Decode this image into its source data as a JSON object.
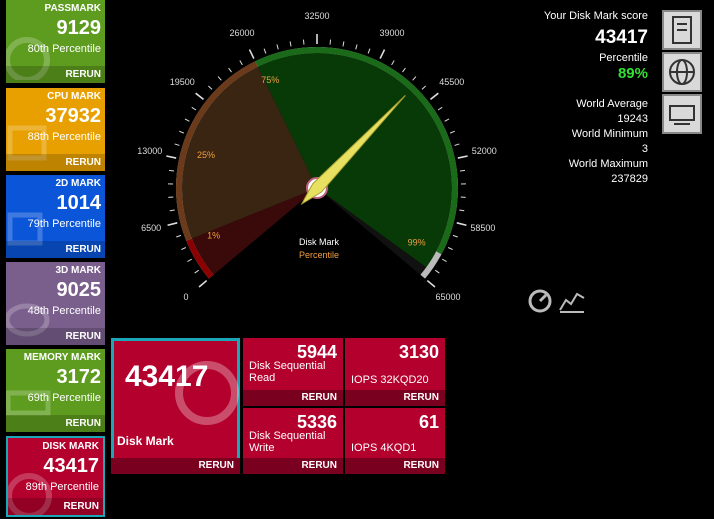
{
  "tiles": [
    {
      "name": "PASSMARK",
      "score": "9129",
      "pct": "80th Percentile",
      "rerun": "RERUN",
      "color": "#5e9c1f"
    },
    {
      "name": "CPU MARK",
      "score": "37932",
      "pct": "88th Percentile",
      "rerun": "RERUN",
      "color": "#e8a000"
    },
    {
      "name": "2D MARK",
      "score": "1014",
      "pct": "79th Percentile",
      "rerun": "RERUN",
      "color": "#0a55d8"
    },
    {
      "name": "3D MARK",
      "score": "9025",
      "pct": "48th Percentile",
      "rerun": "RERUN",
      "color": "#7a5f8c"
    },
    {
      "name": "MEMORY MARK",
      "score": "3172",
      "pct": "69th Percentile",
      "rerun": "RERUN",
      "color": "#5e9c1f"
    },
    {
      "name": "DISK MARK",
      "score": "43417",
      "pct": "89th Percentile",
      "rerun": "RERUN",
      "color": "#b3002d"
    }
  ],
  "gauge": {
    "ticks": [
      "0",
      "6500",
      "13000",
      "19500",
      "26000",
      "32500",
      "39000",
      "45500",
      "52000",
      "58500",
      "65000"
    ],
    "percentile_marks": [
      "1%",
      "25%",
      "75%",
      "99%"
    ],
    "title": "Disk Mark",
    "subtitle": "Percentile",
    "value": 43417,
    "max": 65000
  },
  "summary": {
    "heading": "Your Disk Mark score",
    "score": "43417",
    "pct_label": "Percentile",
    "pct": "89%",
    "avg_label": "World Average",
    "avg": "19243",
    "min_label": "World Minimum",
    "min": "3",
    "max_label": "World Maximum",
    "max": "237829"
  },
  "detail": {
    "main_score": "43417",
    "main_label": "Disk Mark",
    "main_rerun": "RERUN",
    "sub": [
      {
        "value": "5944",
        "name1": "Disk Sequential",
        "name2": "Read",
        "rerun": "RERUN"
      },
      {
        "value": "3130",
        "name1": "IOPS 32KQD20",
        "name2": "",
        "rerun": "RERUN"
      },
      {
        "value": "5336",
        "name1": "Disk Sequential",
        "name2": "Write",
        "rerun": "RERUN"
      },
      {
        "value": "61",
        "name1": "IOPS 4KQD1",
        "name2": "",
        "rerun": "RERUN"
      }
    ]
  }
}
